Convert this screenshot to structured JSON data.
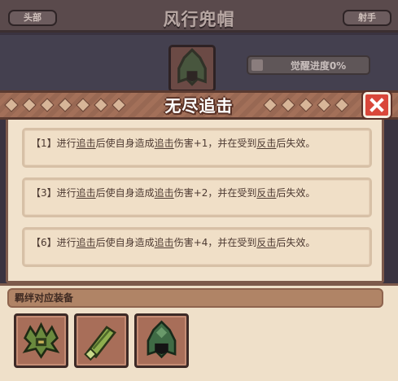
{
  "background": {
    "title": "风行兜帽",
    "left_tab": "头部",
    "right_tab": "射手",
    "awaken_progress": "觉醒进度0%"
  },
  "popup": {
    "title": "无尽追击",
    "effects": [
      {
        "prefix": "【1】进行",
        "kw1": "追击",
        "mid1": "后使自身造成",
        "kw2": "追击",
        "mid2": "伤害+1，并在受到",
        "kw3": "反击",
        "suffix": "后失效。"
      },
      {
        "prefix": "【3】进行",
        "kw1": "追击",
        "mid1": "后使自身造成",
        "kw2": "追击",
        "mid2": "伤害+2，并在受到",
        "kw3": "反击",
        "suffix": "后失效。"
      },
      {
        "prefix": "【6】进行",
        "kw1": "追击",
        "mid1": "后使自身造成",
        "kw2": "追击",
        "mid2": "伤害+4，并在受到",
        "kw3": "反击",
        "suffix": "后失效。"
      }
    ]
  },
  "bond": {
    "label": "羁绊对应装备",
    "items": [
      {
        "icon": "leaf-crown-icon"
      },
      {
        "icon": "leaf-scroll-icon"
      },
      {
        "icon": "hood-icon"
      }
    ]
  },
  "colors": {
    "popup_bg": "#f1e2cc",
    "banner": "#a37059",
    "close_button": "#d9473a",
    "slot": "#a86e59"
  }
}
